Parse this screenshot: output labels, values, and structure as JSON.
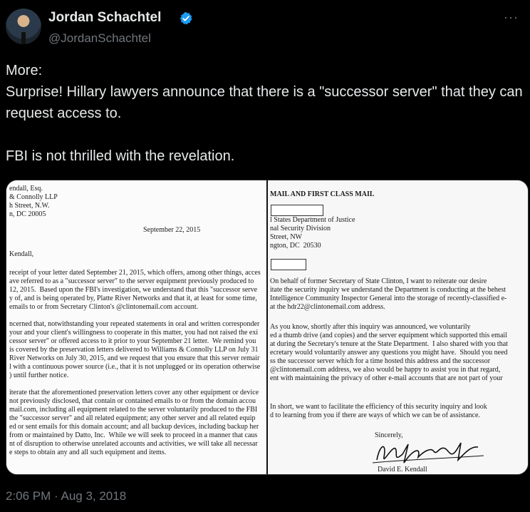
{
  "author": {
    "name": "Jordan Schachtel",
    "handle": "@JordanSchachtel"
  },
  "tweet": {
    "text": "More:\nSurprise! Hillary lawyers announce that there is a \"successor server\" that they can request access to.\n\nFBI is not thrilled with the revelation.",
    "timestamp": "2:06 PM · Aug 3, 2018"
  },
  "more_label": "···",
  "doc_left": {
    "address": [
      "endall, Esq.",
      "& Connolly LLP",
      "h Street, N.W.",
      "n, DC 20005"
    ],
    "date": "September 22, 2015",
    "salutation": "Kendall,",
    "para1": [
      "receipt of your letter dated September 21, 2015, which offers, among other things, acces",
      "ave referred to as a \"successor server\" to the server equipment previously produced to",
      "12, 2015.  Based upon the FBI's investigation, we understand that this \"successor serve",
      "y of, and is being operated by, Platte River Networks and that it, at least for some time,",
      "emails to or from Secretary Clinton's @clintonemail.com account."
    ],
    "para2": [
      "ncerned that, notwithstanding your repeated statements in oral and written corresponder",
      "your and your client's willingness to cooperate in this matter, you had not raised the exi",
      "cessor server\" or offered access to it prior to your September 21 letter.  We remind you",
      "is covered by the preservation letters delivered to Williams & Connolly LLP on July 31",
      "River Networks on July 30, 2015, and we request that you ensure that this server remair",
      "l with a continuous power source (i.e., that it is not unplugged or its operation otherwise",
      ") until further notice."
    ],
    "para3": [
      "iterate that the aforementioned preservation letters cover any other equipment or device",
      "not previously disclosed, that contain or contained emails to or from the domain accou",
      "mail.com, including all equipment related to the server voluntarily produced to the FBI",
      "the \"successor server\" and all related equipment; any other server and all related equip",
      "ed or sent emails for this domain account; and all backup devices, including backup her",
      "from or maintained by Datto, Inc.  While we will seek to proceed in a manner that caus",
      "nt of disruption to otherwise unrelated accounts and activities, we will take all necessar",
      "e steps to obtain any and all such equipment and items."
    ]
  },
  "doc_right": {
    "mail_heading": "MAIL AND FIRST CLASS MAIL",
    "address": [
      "l States Department of Justice",
      "nal Security Division",
      "Street, NW",
      "ngton, DC  20530"
    ],
    "para1": [
      "On behalf of former Secretary of State Clinton, I want to reiterate our desire",
      "itate the security inquiry we understand the Department is conducting at the behest",
      "Intelligence Community Inspector General into the storage of recently-classified e-",
      "at the hdr22@clintonemail.com address."
    ],
    "para2": [
      "As you know, shortly after this inquiry was announced, we voluntarily",
      "ed a thumb drive (and copies) and the server equipment which supported this email",
      "at during the Secretary's tenure at the State Department.  I also shared with you that",
      "ecretary would voluntarily answer any questions you might have.  Should you need",
      "ss the successor server which for a time hosted this address and the successor",
      "@clintonemail.com address, we also would be happy to assist you in that regard,",
      "ent with maintaining the privacy of other e-mail accounts that are not part of your"
    ],
    "para3": [
      "In short, we want to facilitate the efficiency of this security inquiry and look",
      "d to learning from you if there are ways of which we can be of assistance."
    ],
    "closing": "Sincerely,",
    "signer": "David E. Kendall"
  }
}
